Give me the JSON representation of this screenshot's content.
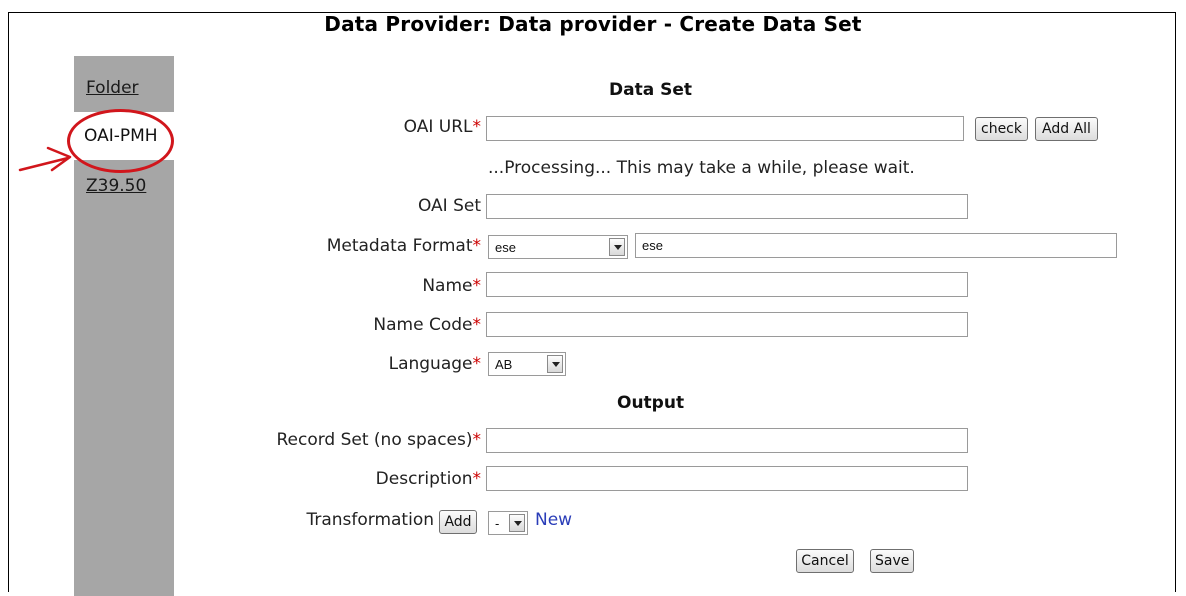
{
  "header": {
    "title": "Data Provider: Data provider - Create Data Set"
  },
  "sidebar": {
    "items": [
      {
        "label": "Folder"
      },
      {
        "label": "OAI-PMH"
      },
      {
        "label": "Z39.50"
      }
    ]
  },
  "form": {
    "data_set_heading": "Data Set",
    "oai_url": {
      "label": "OAI URL",
      "value": "",
      "check_label": "check",
      "add_all_label": "Add All"
    },
    "processing_text": "...Processing... This may take a while, please wait.",
    "oai_set": {
      "label": "OAI Set",
      "value": ""
    },
    "metadata_format": {
      "label": "Metadata Format",
      "selected": "ese",
      "value": "ese"
    },
    "name": {
      "label": "Name",
      "value": ""
    },
    "name_code": {
      "label": "Name Code",
      "value": ""
    },
    "language": {
      "label": "Language",
      "selected": "AB"
    },
    "output_heading": "Output",
    "record_set": {
      "label": "Record Set (no spaces)",
      "value": ""
    },
    "description": {
      "label": "Description",
      "value": ""
    },
    "transformation": {
      "label": "Transformation",
      "add_label": "Add",
      "selected": "-",
      "new_label": "New"
    },
    "required_mark": "*",
    "cancel_label": "Cancel",
    "save_label": "Save"
  },
  "annotation": {
    "color": "#d1161c"
  }
}
